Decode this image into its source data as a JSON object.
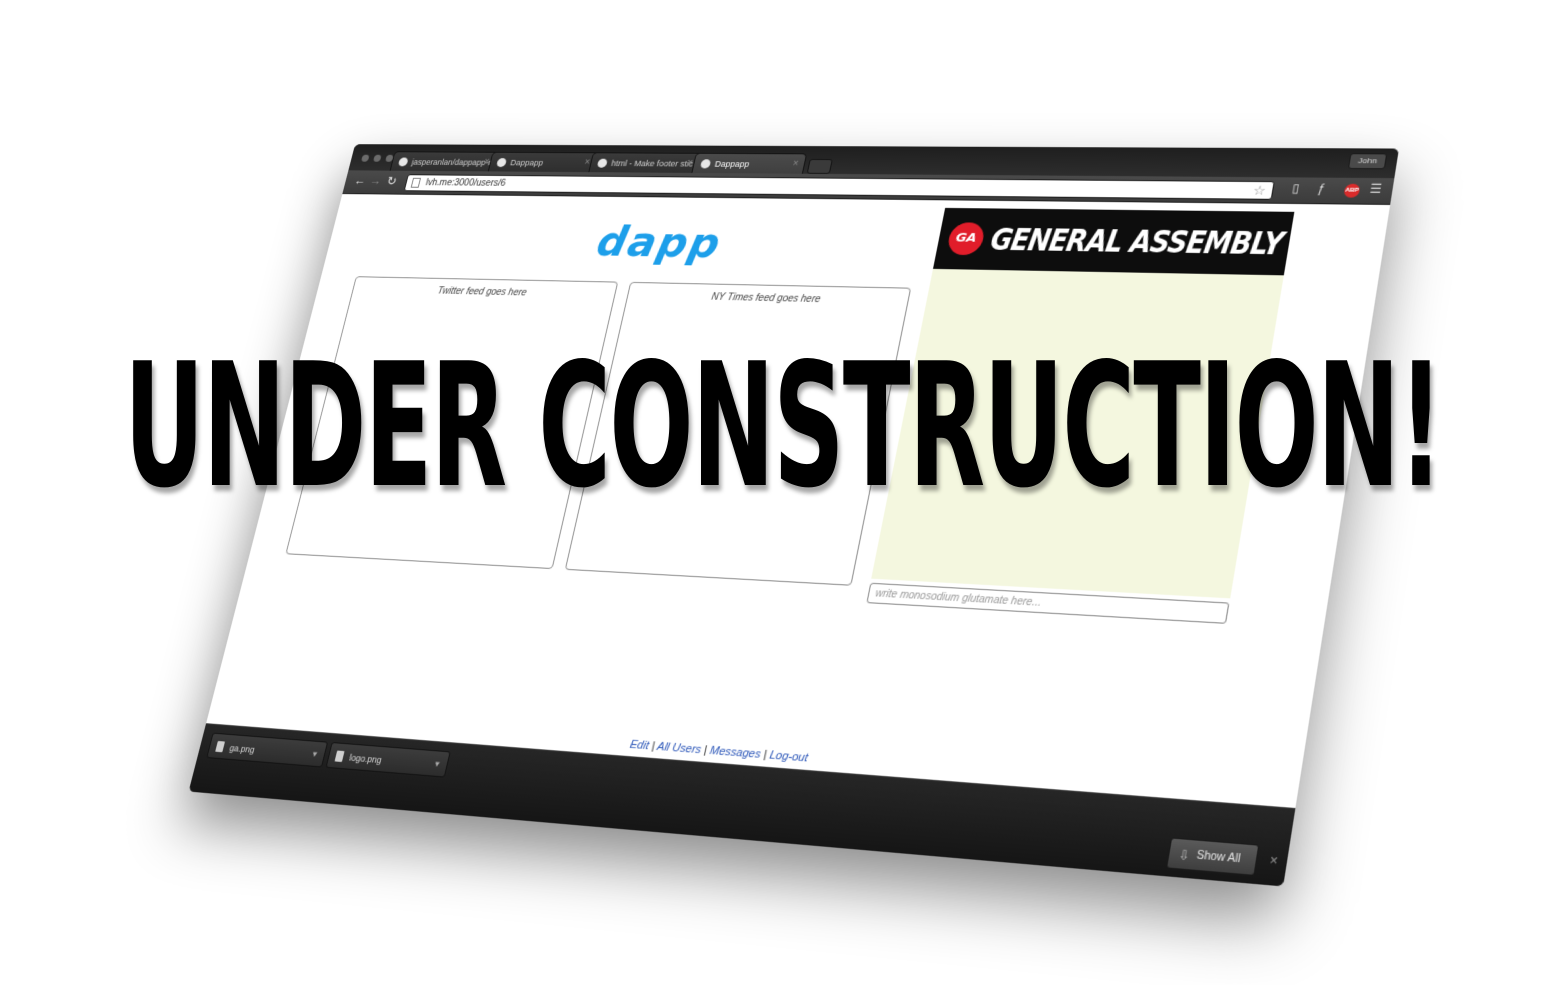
{
  "browser": {
    "tabs": [
      {
        "label": "jasperanlan/dappapp-rails"
      },
      {
        "label": "Dappapp"
      },
      {
        "label": "html - Make footer stick to"
      },
      {
        "label": "Dappapp"
      }
    ],
    "profile_label": "John",
    "address": "lvh.me:3000/users/6"
  },
  "page": {
    "logo_text": "dapp",
    "logo_color": "#1d9fea",
    "ga_badge": "GA",
    "ga_title": "GENERAL ASSEMBLY",
    "ga_accent": "#e11d2a",
    "ga_panel_color": "#f4f7df",
    "twitter_feed_label": "Twitter feed goes here",
    "nytimes_feed_label": "NY Times feed goes here",
    "compose_placeholder": "write monosodium glutamate here...",
    "footer_links": {
      "edit": "Edit",
      "all_users": "All Users",
      "messages": "Messages",
      "logout": "Log-out",
      "separator": " | "
    }
  },
  "downloads": {
    "items": [
      {
        "name": "ga.png"
      },
      {
        "name": "logo.png"
      }
    ],
    "show_all_label": "Show All"
  },
  "overlay": {
    "text": "UNDER CONSTRUCTION!"
  }
}
